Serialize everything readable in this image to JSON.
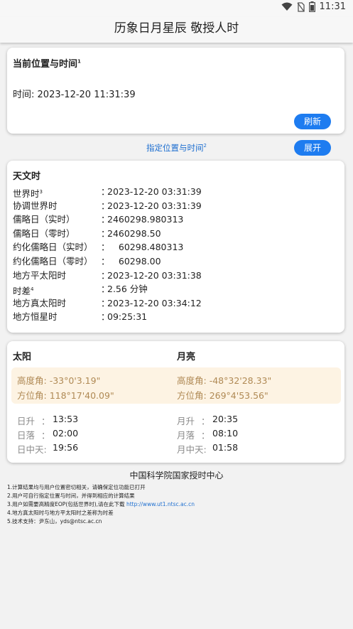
{
  "status": {
    "time": "11:31"
  },
  "app": {
    "title": "历象日月星辰  敬授人时"
  },
  "current": {
    "title": "当前位置与时间",
    "title_sup": "1",
    "time_label": "时间:",
    "time_value": "2023-12-20 11:31:39",
    "refresh_label": "刷新"
  },
  "specify": {
    "label": "指定位置与时间",
    "label_sup": "2",
    "expand_label": "展开"
  },
  "astro": {
    "title": "天文时",
    "rows": [
      {
        "label": "世界时",
        "sup": "3",
        "value": "2023-12-20 03:31:39"
      },
      {
        "label": "协调世界时",
        "sup": "",
        "value": "2023-12-20 03:31:39"
      },
      {
        "label": "儒略日（实时）",
        "sup": "",
        "value": "2460298.980313"
      },
      {
        "label": "儒略日（零时）",
        "sup": "",
        "value": "2460298.50"
      },
      {
        "label": "约化儒略日（实时）",
        "sup": "",
        "value": "    60298.480313"
      },
      {
        "label": "约化儒略日（零时）",
        "sup": "",
        "value": "    60298.00"
      },
      {
        "label": "地方平太阳时",
        "sup": "",
        "value": "2023-12-20 03:31:38"
      },
      {
        "label": "时差",
        "sup": "4",
        "value": "2.56 分钟"
      },
      {
        "label": "地方真太阳时",
        "sup": "",
        "value": "2023-12-20 03:34:12"
      },
      {
        "label": "地方恒星时",
        "sup": "",
        "value": "09:25:31"
      }
    ],
    "colon": "："
  },
  "sunmoon": {
    "sun_title": "太阳",
    "moon_title": "月亮",
    "sun_alt_label": "高度角:",
    "sun_alt": "-33°0'3.19\"",
    "sun_az_label": "方位角:",
    "sun_az": "118°17'40.09\"",
    "moon_alt_label": "高度角:",
    "moon_alt": "-48°32'28.33\"",
    "moon_az_label": "方位角:",
    "moon_az": "269°4'53.56\"",
    "sunrise_label": "日升",
    "sunrise": "13:53",
    "sunset_label": "日落",
    "sunset": "02:00",
    "sun_transit_label": "日中天:",
    "sun_transit": "19:56",
    "moonrise_label": "月升",
    "moonrise": "20:35",
    "moonset_label": "月落",
    "moonset": "08:10",
    "moon_transit_label": "月中天:",
    "moon_transit": "01:58",
    "colon": "："
  },
  "footer": {
    "org": "中国科学院国家授时中心",
    "notes": [
      "1.计算结果均与用户位置密切相关，请确保定位功能已打开",
      "2.用户可自行指定位置与时间，并得到相应的计算结果",
      "3.用户如需要高精度EOP(包括世界时),请在此下载",
      "4.地方真太阳时与地方平太阳时之差称为时差",
      "5.技术支持：尹东山，yds@ntsc.ac.cn"
    ],
    "link": "http://www.ut1.ntsc.ac.cn"
  },
  "colors": {
    "accent": "#1e7cf0",
    "highlight_bg": "#fdf3e3",
    "highlight_text": "#b08a55"
  }
}
